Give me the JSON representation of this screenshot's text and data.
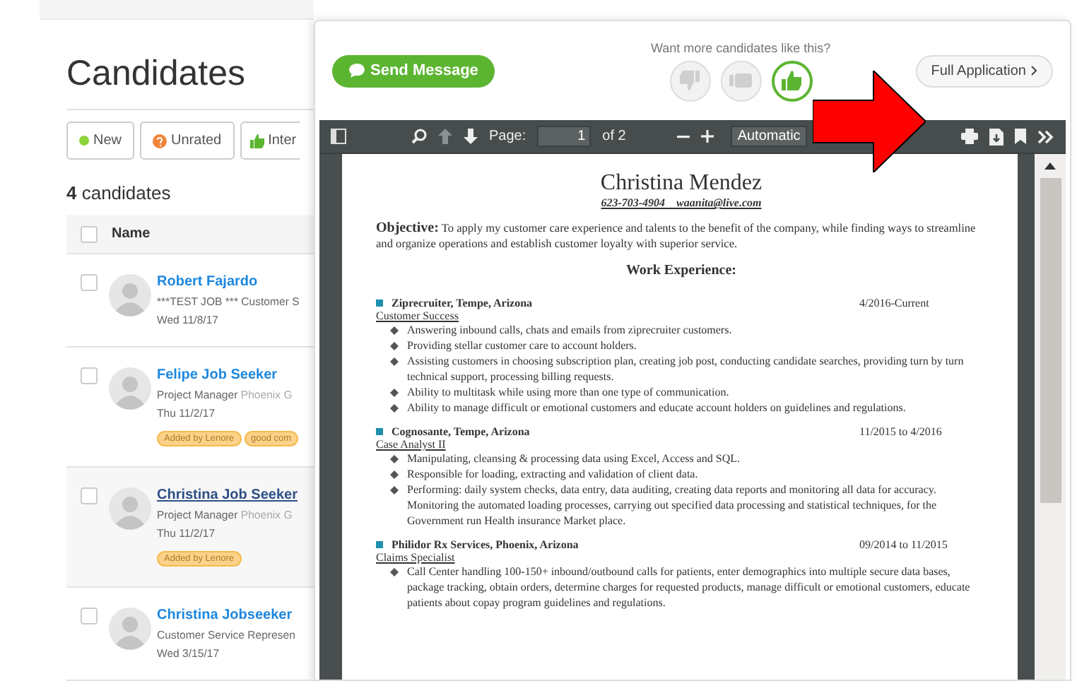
{
  "page": {
    "title": "Candidates",
    "filters": [
      {
        "kind": "dot",
        "label": "New"
      },
      {
        "kind": "question",
        "label": "Unrated"
      },
      {
        "kind": "thumb",
        "label": "Inter"
      }
    ],
    "count": "**4** candidates",
    "table": {
      "header_checked": false,
      "header": "Name",
      "rows": [
        {
          "name": "Robert Fajardo",
          "job": "***TEST JOB *** Customer S",
          "company": "",
          "date": "Wed 11/8/17",
          "tags": [],
          "selected": false,
          "checked": false
        },
        {
          "name": "Felipe Job Seeker",
          "job": "Project Manager",
          "company": "Phoenix G",
          "date": "Thu 11/2/17",
          "tags": [
            "Added by Lenore",
            "good com"
          ],
          "selected": false,
          "checked": false
        },
        {
          "name": "Christina Job Seeker",
          "job": "Project Manager",
          "company": "Phoenix G",
          "date": "Thu 11/2/17",
          "tags": [
            "Added by Lenore"
          ],
          "selected": true,
          "checked": false
        },
        {
          "name": "Christina Jobseeker",
          "job": "Customer Service Represen",
          "company": "",
          "date": "Wed 3/15/17",
          "tags": [],
          "selected": false,
          "checked": false
        }
      ]
    }
  },
  "popup": {
    "send_button": "Send Message",
    "prompt": "Want more candidates like this?",
    "ratings": [
      {
        "kind": "down",
        "selected": false
      },
      {
        "kind": "neutral",
        "selected": false
      },
      {
        "kind": "up",
        "selected": true
      }
    ],
    "full_application": "Full Application"
  },
  "pdf_toolbar": {
    "page_label": "Page:",
    "page_value": "1",
    "page_total": "of 2",
    "zoom": "Automatic"
  },
  "resume": {
    "name": "Christina Mendez",
    "contact": "623-703-4904    waanita@live.com",
    "objective": "**Objective:** To apply my customer care experience and talents to the benefit of the company, while finding ways to streamline and organize operations and establish customer loyalty with superior service.",
    "section": "Work Experience:",
    "jobs": [
      {
        "company": "Ziprecruiter, Tempe, Arizona",
        "dates": "4/2016-Current",
        "role": "Customer Success",
        "bullets": [
          "Answering inbound calls, chats and emails from ziprecruiter customers.",
          "Providing stellar customer care to account holders.",
          "Assisting customers in choosing subscription plan, creating job post, conducting candidate searches, providing turn by turn technical support, processing billing requests.",
          "Ability to multitask while using more than one type of communication.",
          "Ability to manage difficult or emotional customers and educate account holders on guidelines and regulations."
        ]
      },
      {
        "company": "Cognosante, Tempe, Arizona",
        "dates": "11/2015 to 4/2016",
        "role": "Case Analyst II",
        "bullets": [
          "Manipulating, cleansing & processing data using Excel, Access and SQL.",
          "Responsible for loading, extracting and validation of client data.",
          "Performing: daily system checks, data entry, data auditing, creating data reports and monitoring all data for accuracy. Monitoring the automated loading processes, carrying out specified data processing and statistical techniques, for the Government run Health insurance Market place."
        ]
      },
      {
        "company": "Philidor Rx Services, Phoenix, Arizona",
        "dates": "09/2014 to 11/2015",
        "role": "Claims Specialist",
        "bullets": [
          "Call Center handling 100-150+ inbound/outbound calls for patients, enter demographics into multiple secure data bases, package tracking, obtain orders, determine charges for requested products, manage difficult or emotional customers, educate patients about copay program guidelines and regulations."
        ]
      }
    ]
  }
}
